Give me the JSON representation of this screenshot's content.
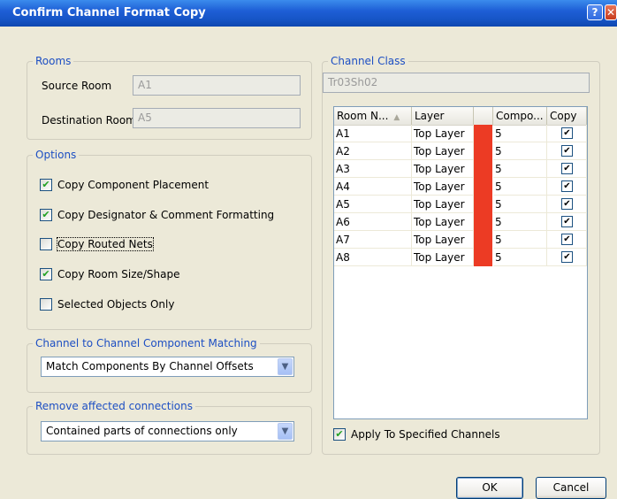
{
  "window": {
    "title": "Confirm Channel Format Copy",
    "help_glyph": "?",
    "close_glyph": "✕"
  },
  "rooms": {
    "legend": "Rooms",
    "source_label": "Source Room",
    "source_value": "A1",
    "destination_label": "Destination Room",
    "destination_value": "A5"
  },
  "options": {
    "legend": "Options",
    "items": [
      {
        "label": "Copy Component Placement",
        "checked": true
      },
      {
        "label": "Copy Designator & Comment Formatting",
        "checked": true
      },
      {
        "label": "Copy Routed Nets",
        "checked": false
      },
      {
        "label": "Copy Room Size/Shape",
        "checked": true
      },
      {
        "label": "Selected Objects Only",
        "checked": false
      }
    ]
  },
  "matching": {
    "legend": "Channel to Channel Component Matching",
    "selected": "Match Components By Channel Offsets"
  },
  "remove": {
    "legend": "Remove affected connections",
    "selected": "Contained parts of connections only"
  },
  "channel_class": {
    "legend": "Channel Class",
    "value": "Tr03Sh02",
    "columns": [
      "Room N...",
      "Layer",
      "",
      "Compo...",
      "Copy"
    ],
    "sort_glyph": "▲",
    "layer_color": "#ec3b24",
    "rows": [
      {
        "room": "A1",
        "layer": "Top Layer",
        "components": "5",
        "copy": true
      },
      {
        "room": "A2",
        "layer": "Top Layer",
        "components": "5",
        "copy": true
      },
      {
        "room": "A3",
        "layer": "Top Layer",
        "components": "5",
        "copy": true
      },
      {
        "room": "A4",
        "layer": "Top Layer",
        "components": "5",
        "copy": true
      },
      {
        "room": "A5",
        "layer": "Top Layer",
        "components": "5",
        "copy": true
      },
      {
        "room": "A6",
        "layer": "Top Layer",
        "components": "5",
        "copy": true
      },
      {
        "room": "A7",
        "layer": "Top Layer",
        "components": "5",
        "copy": true
      },
      {
        "room": "A8",
        "layer": "Top Layer",
        "components": "5",
        "copy": true
      }
    ],
    "apply_label": "Apply To Specified Channels",
    "apply_checked": true
  },
  "buttons": {
    "ok": "OK",
    "cancel": "Cancel"
  },
  "icons": {
    "dropdown": "chevron-down-icon",
    "check": "checkmark-icon",
    "help": "help-icon",
    "close": "close-icon"
  }
}
